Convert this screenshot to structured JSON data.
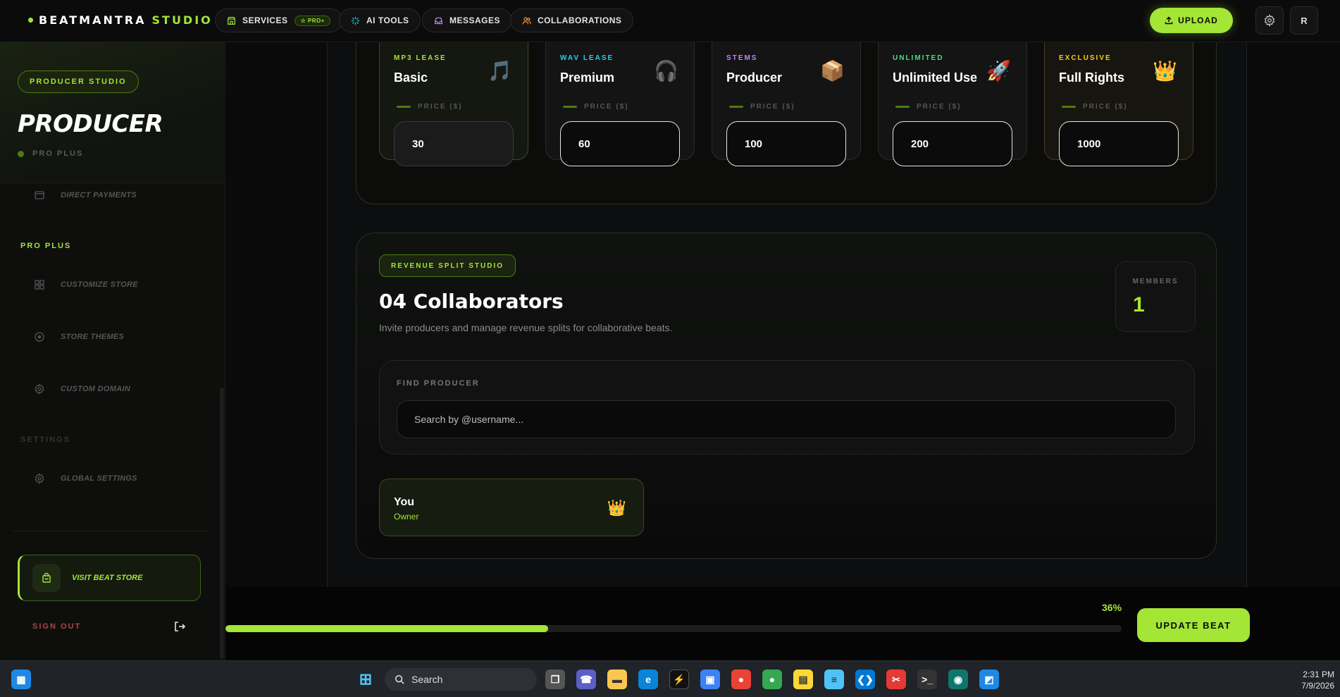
{
  "topnav": {
    "brand_main": "BEATMANTRA",
    "brand_accent": "STUDIO",
    "nav": [
      {
        "label": "SERVICES",
        "tag": "☆ PRO+"
      },
      {
        "label": "AI TOOLS"
      },
      {
        "label": "MESSAGES"
      },
      {
        "label": "COLLABORATIONS"
      }
    ],
    "upload_label": "UPLOAD",
    "avatar_initial": "R",
    "accent_color": "#a3e635"
  },
  "sidebar": {
    "badge": "PRODUCER STUDIO",
    "title": "PRODUCER",
    "plan": "PRO PLUS",
    "items_top": [
      {
        "label": "DIRECT PAYMENTS",
        "icon": "wallet-icon"
      }
    ],
    "section_pro": "PRO PLUS",
    "items_pro": [
      {
        "label": "CUSTOMIZE STORE",
        "icon": "grid-icon"
      },
      {
        "label": "STORE THEMES",
        "icon": "palette-icon"
      },
      {
        "label": "CUSTOM DOMAIN",
        "icon": "gear-icon"
      }
    ],
    "section_settings": "SETTINGS",
    "items_settings": [
      {
        "label": "GLOBAL SETTINGS",
        "icon": "gear-icon"
      }
    ],
    "visit_store": "VISIT BEAT STORE",
    "sign_out": "SIGN OUT"
  },
  "tiers": [
    {
      "kicker": "MP3 LEASE",
      "name": "Basic",
      "icon": "🎵",
      "price_label": "PRICE ($)",
      "price": "30",
      "kicker_color": "#a3e635"
    },
    {
      "kicker": "WAV LEASE",
      "name": "Premium",
      "icon": "🎧",
      "price_label": "PRICE ($)",
      "price": "60",
      "kicker_color": "#22d3ee"
    },
    {
      "kicker": "STEMS",
      "name": "Producer",
      "icon": "📦",
      "price_label": "PRICE ($)",
      "price": "100",
      "kicker_color": "#c084fc"
    },
    {
      "kicker": "UNLIMITED",
      "name": "Unlimited Use",
      "icon": "🚀",
      "price_label": "PRICE ($)",
      "price": "200",
      "kicker_color": "#4ade80"
    },
    {
      "kicker": "EXCLUSIVE",
      "name": "Full Rights",
      "icon": "👑",
      "price_label": "PRICE ($)",
      "price": "1000",
      "kicker_color": "#facc15"
    }
  ],
  "revenue": {
    "badge": "REVENUE SPLIT STUDIO",
    "title": "04 Collaborators",
    "subtitle": "Invite producers and manage revenue splits for collaborative beats.",
    "members_label": "MEMBERS",
    "members_count": "1",
    "find_label": "FIND PRODUCER",
    "search_placeholder": "Search by @username...",
    "owner_name": "You",
    "owner_role": "Owner",
    "owner_icon": "👑"
  },
  "bottom": {
    "progress_percent": 36,
    "progress_text": "36%",
    "update_label": "UPDATE BEAT"
  },
  "taskbar": {
    "search_label": "Search",
    "time": "2:31 PM",
    "date": "7/9/2026"
  }
}
